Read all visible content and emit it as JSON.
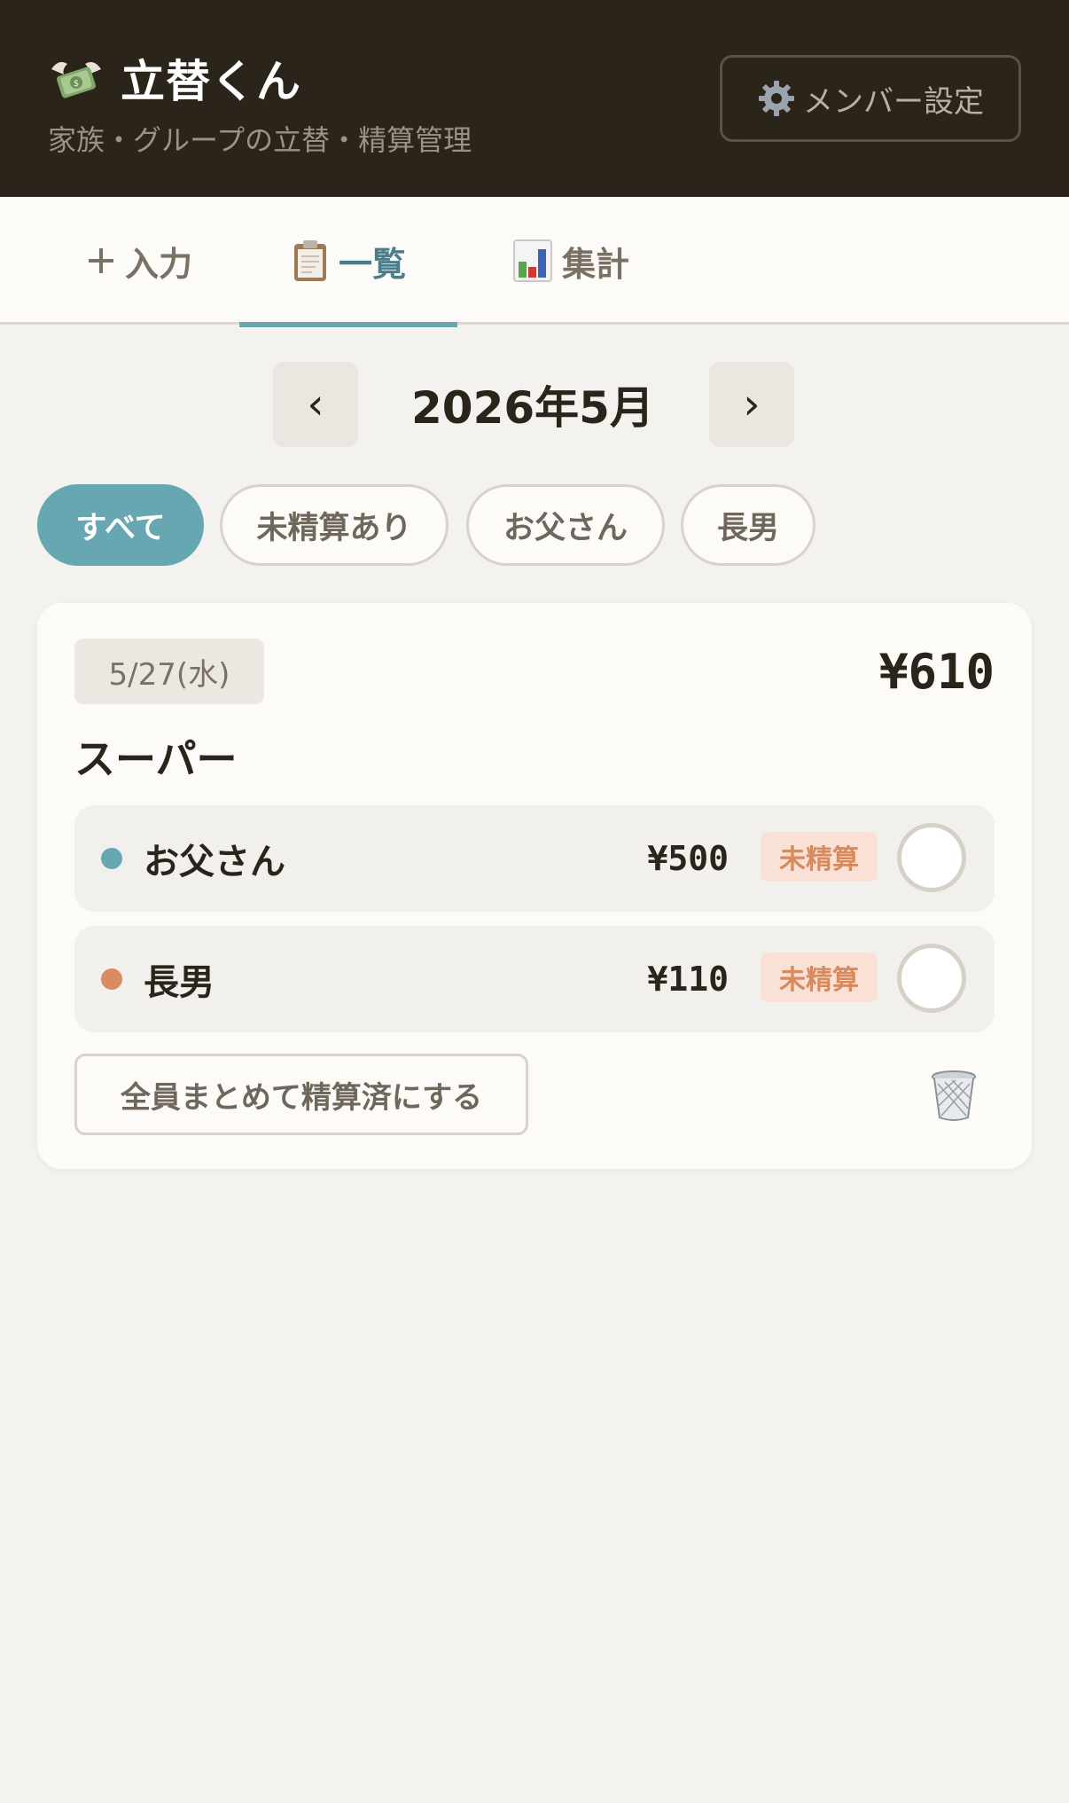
{
  "header": {
    "title": "立替くん",
    "subtitle": "家族・グループの立替・精算管理",
    "member_settings_label": "メンバー設定"
  },
  "tabs": [
    {
      "label": "入力",
      "icon": "plus-icon",
      "active": false
    },
    {
      "label": "一覧",
      "icon": "clipboard-icon",
      "active": true
    },
    {
      "label": "集計",
      "icon": "bar-chart-icon",
      "active": false
    }
  ],
  "month_nav": {
    "prev_label": "‹",
    "current": "2026年5月",
    "next_label": "›"
  },
  "filters": [
    {
      "label": "すべて",
      "active": true
    },
    {
      "label": "未精算あり",
      "active": false
    },
    {
      "label": "お父さん",
      "active": false
    },
    {
      "label": "長男",
      "active": false
    }
  ],
  "entries": [
    {
      "date": "5/27(水)",
      "total": "¥610",
      "title": "スーパー",
      "people": [
        {
          "name": "お父さん",
          "amount": "¥500",
          "status": "未精算",
          "dot_color": "#67a7b2"
        },
        {
          "name": "長男",
          "amount": "¥110",
          "status": "未精算",
          "dot_color": "#dc8a62"
        }
      ],
      "settle_all_label": "全員まとめて精算済にする"
    }
  ],
  "colors": {
    "header_bg": "#2b241a",
    "accent": "#67a7b2",
    "unsettled_text": "#d88a5f",
    "unsettled_bg": "#f9e1d5"
  }
}
